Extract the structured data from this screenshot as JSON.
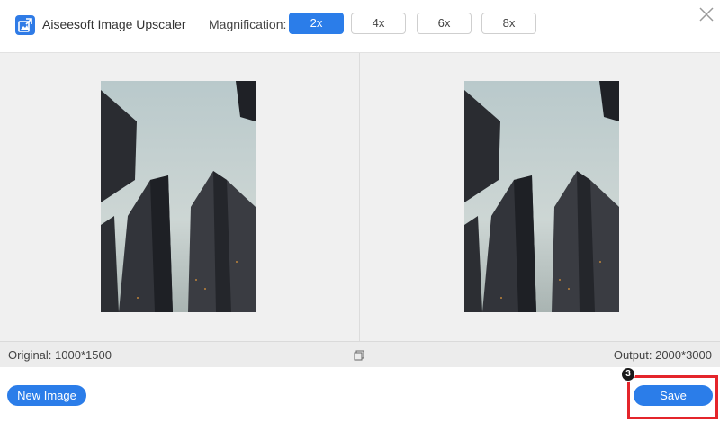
{
  "app": {
    "title": "Aiseesoft Image Upscaler"
  },
  "magnification": {
    "label": "Magnification:",
    "options": [
      "2x",
      "4x",
      "6x",
      "8x"
    ],
    "selected": "2x"
  },
  "info": {
    "original": "Original: 1000*1500",
    "output": "Output: 2000*3000"
  },
  "footer": {
    "new_image_label": "New Image",
    "save_label": "Save",
    "step_number": "3"
  },
  "colors": {
    "accent": "#2b7de9",
    "highlight": "#e4252b",
    "preview_bg": "#f0f0f0"
  },
  "icons": [
    "app-logo-icon",
    "close-icon",
    "compare-icon"
  ]
}
